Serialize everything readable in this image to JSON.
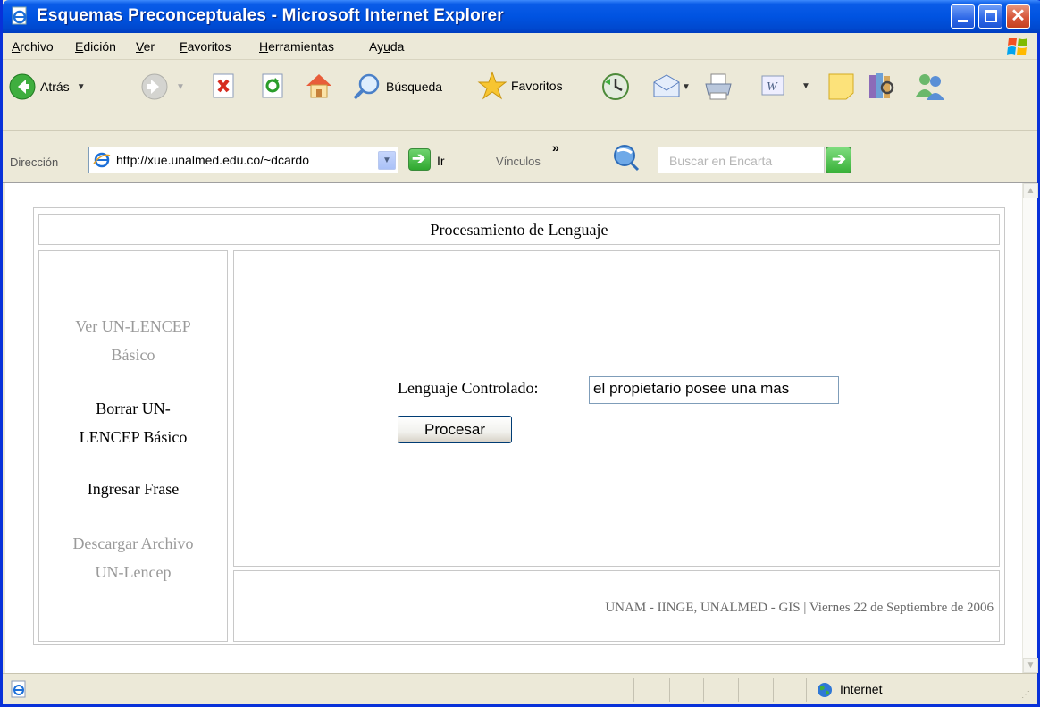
{
  "window": {
    "title": "Esquemas Preconceptuales - Microsoft Internet Explorer"
  },
  "menu": {
    "items": [
      "Archivo",
      "Edición",
      "Ver",
      "Favoritos",
      "Herramientas",
      "Ayuda"
    ],
    "accelerators": [
      "A",
      "E",
      "V",
      "F",
      "H",
      "u"
    ]
  },
  "toolbar": {
    "back_label": "Atrás",
    "search_label": "Búsqueda",
    "favorites_label": "Favoritos"
  },
  "address": {
    "label": "Dirección",
    "url": "http://xue.unalmed.edu.co/~dcardo",
    "go_label": "Ir",
    "links_label": "Vínculos",
    "links_chevron": "»",
    "encarta_placeholder": "Buscar en Encarta"
  },
  "page": {
    "header": "Procesamiento de Lenguaje",
    "sidebar": [
      {
        "label_lines": [
          "Ver UN-LENCEP",
          "Básico"
        ],
        "enabled": false
      },
      {
        "label_lines": [
          "Borrar UN-",
          "LENCEP Básico"
        ],
        "enabled": true
      },
      {
        "label_lines": [
          "Ingresar Frase"
        ],
        "enabled": true
      },
      {
        "label_lines": [
          "Descargar Archivo",
          "UN-Lencep"
        ],
        "enabled": false
      }
    ],
    "form": {
      "label": "Lenguaje Controlado:",
      "input_value": "el propietario posee una mas",
      "submit_label": "Procesar"
    },
    "footer": "UNAM - IINGE, UNALMED - GIS | Viernes 22 de Septiembre de 2006"
  },
  "status": {
    "zone": "Internet"
  },
  "colors": {
    "titlebar": "#0053e1",
    "chrome": "#ece9d8",
    "disabled_link": "#9a9a9a",
    "footer_text": "#6b6b6b"
  },
  "icons": [
    "ie-page-icon",
    "minimize-icon",
    "maximize-icon",
    "close-icon",
    "windows-logo-icon",
    "back-arrow-icon",
    "forward-arrow-icon",
    "stop-icon",
    "refresh-icon",
    "home-icon",
    "search-magnifier-icon",
    "favorites-star-icon",
    "history-icon",
    "mail-icon",
    "print-icon",
    "word-icon",
    "notes-icon",
    "research-icon",
    "messenger-icon",
    "go-arrow-icon",
    "encarta-icon",
    "internet-globe-icon"
  ]
}
